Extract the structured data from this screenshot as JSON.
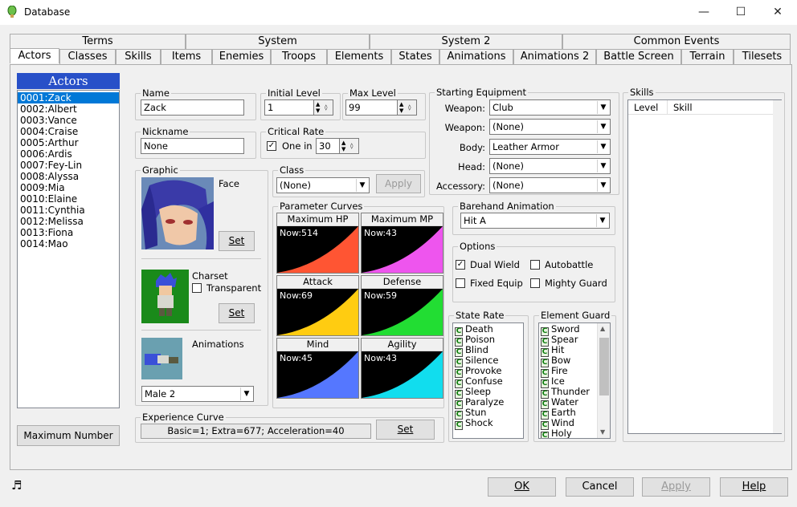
{
  "window": {
    "title": "Database",
    "minimize": "—",
    "maximize": "☐",
    "close": "✕"
  },
  "tabs_row1": [
    "Terms",
    "System",
    "System 2",
    "Common Events"
  ],
  "tabs_row2": [
    "Actors",
    "Classes",
    "Skills",
    "Items",
    "Enemies",
    "Troops",
    "Elements",
    "States",
    "Animations",
    "Animations 2",
    "Battle Screen",
    "Terrain",
    "Tilesets"
  ],
  "actors": {
    "header": "Actors",
    "items": [
      "0001:Zack",
      "0002:Albert",
      "0003:Vance",
      "0004:Craise",
      "0005:Arthur",
      "0006:Ardis",
      "0007:Fey-Lin",
      "0008:Alyssa",
      "0009:Mia",
      "0010:Elaine",
      "0011:Cynthia",
      "0012:Melissa",
      "0013:Fiona",
      "0014:Mao"
    ],
    "selected_index": 0,
    "max_button": "Maximum Number"
  },
  "name": {
    "label": "Name",
    "value": "Zack"
  },
  "initial_level": {
    "label": "Initial Level",
    "value": "1"
  },
  "max_level": {
    "label": "Max Level",
    "value": "99"
  },
  "nickname": {
    "label": "Nickname",
    "value": "None"
  },
  "critical": {
    "label": "Critical Rate",
    "check_label": "One in",
    "checked": true,
    "value": "30"
  },
  "graphic": {
    "label": "Graphic",
    "face_label": "Face",
    "set": "Set",
    "charset_label": "Charset",
    "transparent_label": "Transparent",
    "animations_label": "Animations",
    "animation_value": "Male 2"
  },
  "class_box": {
    "label": "Class",
    "value": "(None)",
    "apply": "Apply"
  },
  "curves": {
    "label": "Parameter Curves",
    "items": [
      {
        "title": "Maximum HP",
        "now": "Now:514",
        "color": "#ff5533"
      },
      {
        "title": "Maximum MP",
        "now": "Now:43",
        "color": "#ee55ee"
      },
      {
        "title": "Attack",
        "now": "Now:69",
        "color": "#ffcc11"
      },
      {
        "title": "Defense",
        "now": "Now:59",
        "color": "#22dd33"
      },
      {
        "title": "Mind",
        "now": "Now:45",
        "color": "#5577ff"
      },
      {
        "title": "Agility",
        "now": "Now:43",
        "color": "#11ddee"
      }
    ]
  },
  "experience": {
    "label": "Experience Curve",
    "value": "Basic=1; Extra=677; Acceleration=40",
    "set": "Set"
  },
  "equipment": {
    "label": "Starting Equipment",
    "rows": [
      {
        "label": "Weapon:",
        "value": "Club"
      },
      {
        "label": "Weapon:",
        "value": "(None)"
      },
      {
        "label": "Body:",
        "value": "Leather Armor"
      },
      {
        "label": "Head:",
        "value": "(None)"
      },
      {
        "label": "Accessory:",
        "value": "(None)"
      }
    ]
  },
  "barehand": {
    "label": "Barehand Animation",
    "value": "Hit A"
  },
  "options": {
    "label": "Options",
    "dual_wield": "Dual Wield",
    "autobattle": "Autobattle",
    "fixed_equip": "Fixed Equip",
    "mighty_guard": "Mighty Guard"
  },
  "state_rate": {
    "label": "State Rate",
    "items": [
      "Death",
      "Poison",
      "Blind",
      "Silence",
      "Provoke",
      "Confuse",
      "Sleep",
      "Paralyze",
      "Stun",
      "Shock"
    ]
  },
  "element_guard": {
    "label": "Element Guard",
    "items": [
      "Sword",
      "Spear",
      "Hit",
      "Bow",
      "Fire",
      "Ice",
      "Thunder",
      "Water",
      "Earth",
      "Wind",
      "Holy"
    ]
  },
  "rate_letter": "C",
  "skills": {
    "label": "Skills",
    "col_level": "Level",
    "col_skill": "Skill"
  },
  "footer": {
    "music_icon": "♬",
    "ok": "OK",
    "cancel": "Cancel",
    "apply": "Apply",
    "help": "Help"
  }
}
